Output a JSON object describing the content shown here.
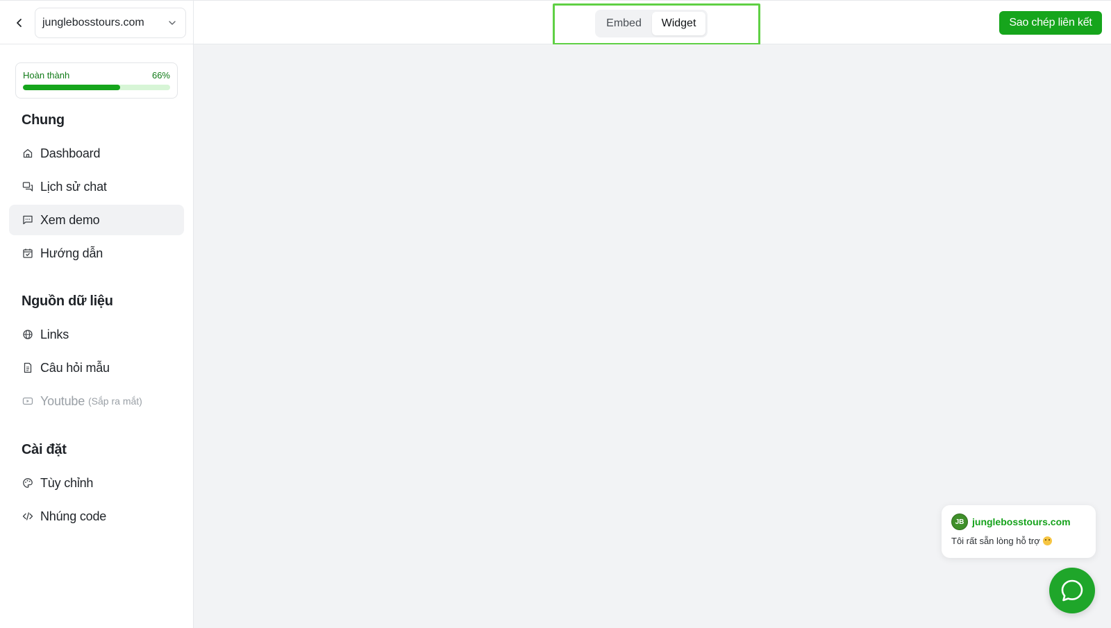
{
  "topbar": {
    "site_select": {
      "value": "junglebosstours.com"
    },
    "tabs": [
      {
        "label": "Embed",
        "active": false
      },
      {
        "label": "Widget",
        "active": true
      }
    ],
    "copy_link_label": "Sao chép liên kết"
  },
  "sidebar": {
    "progress": {
      "label": "Hoàn thành",
      "percent_label": "66%",
      "value": 0.66
    },
    "sections": [
      {
        "title": "Chung",
        "items": [
          {
            "label": "Dashboard",
            "icon": "home-icon"
          },
          {
            "label": "Lịch sử chat",
            "icon": "chat-history-icon"
          },
          {
            "label": "Xem demo",
            "icon": "message-square-icon",
            "active": true
          },
          {
            "label": "Hướng dẫn",
            "icon": "calendar-check-icon"
          }
        ]
      },
      {
        "title": "Nguồn dữ liệu",
        "items": [
          {
            "label": "Links",
            "icon": "globe-icon"
          },
          {
            "label": "Câu hỏi mẫu",
            "icon": "document-icon"
          },
          {
            "label": "Youtube",
            "sub": "(Sắp ra mắt)",
            "icon": "youtube-icon",
            "disabled": true
          }
        ]
      },
      {
        "title": "Cài đặt",
        "items": [
          {
            "label": "Tùy chỉnh",
            "icon": "palette-icon"
          },
          {
            "label": "Nhúng code",
            "icon": "code-icon"
          }
        ]
      }
    ]
  },
  "widget": {
    "logo_text": "JB",
    "name": "junglebosstours.com",
    "message": "Tôi rất sẵn lòng hỗ trợ"
  },
  "colors": {
    "accent": "#16a51c",
    "highlight": "#5fd044",
    "main_bg": "#f2f3f5"
  }
}
